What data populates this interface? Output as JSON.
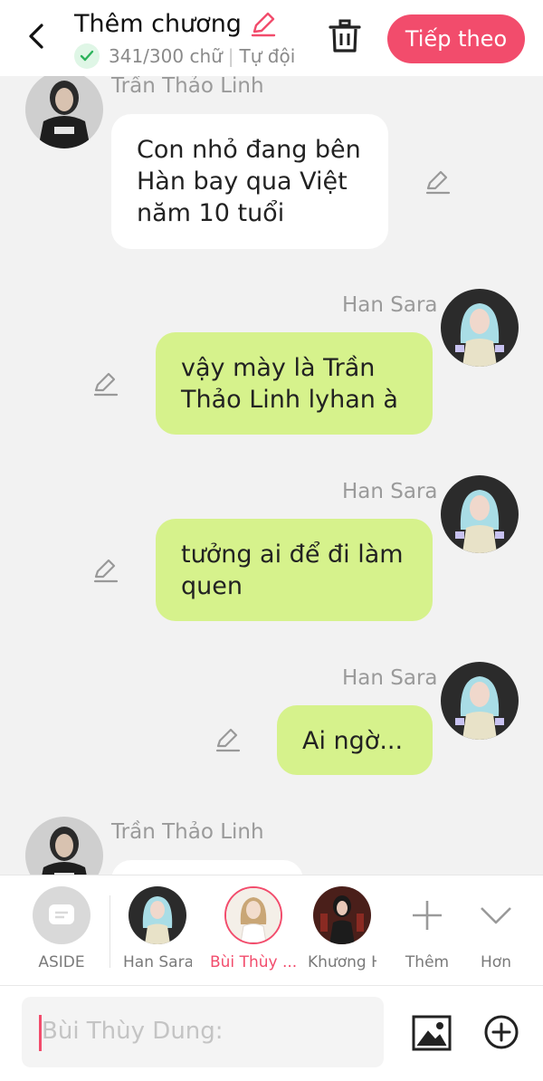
{
  "header": {
    "title": "Thêm chương",
    "word_count": "341/300 chữ",
    "separator": "|",
    "autosave": "Tự đội",
    "next_button": "Tiếp theo",
    "accent": "#f24c6c"
  },
  "messages": [
    {
      "speaker": "Trần Thảo Linh",
      "side": "left",
      "text": "Con nhỏ đang bên Hàn bay qua Việt năm 10 tuổi"
    },
    {
      "speaker": "Han Sara",
      "side": "right",
      "text": "vậy mày là Trần Thảo Linh lyhan à"
    },
    {
      "speaker": "Han Sara",
      "side": "right",
      "text": "tưởng ai để đi làm quen"
    },
    {
      "speaker": "Han Sara",
      "side": "right",
      "text": "Ai ngờ..."
    },
    {
      "speaker": "Trần Thảo Linh",
      "side": "left",
      "text": ""
    }
  ],
  "characters": [
    {
      "label": "ASIDE",
      "icon": "aside-icon"
    },
    {
      "label": "Han Sara"
    },
    {
      "label": "Bùi Thùy ...",
      "selected": true
    },
    {
      "label": "Khương H"
    },
    {
      "label": "Thêm",
      "icon": "plus-icon"
    },
    {
      "label": "Hơn",
      "icon": "chevron-down-icon"
    }
  ],
  "input": {
    "placeholder": "Bùi Thùy Dung:"
  },
  "colors": {
    "left_bubble": "#ffffff",
    "right_bubble": "#d6f28c",
    "background": "#f2f2f2"
  }
}
